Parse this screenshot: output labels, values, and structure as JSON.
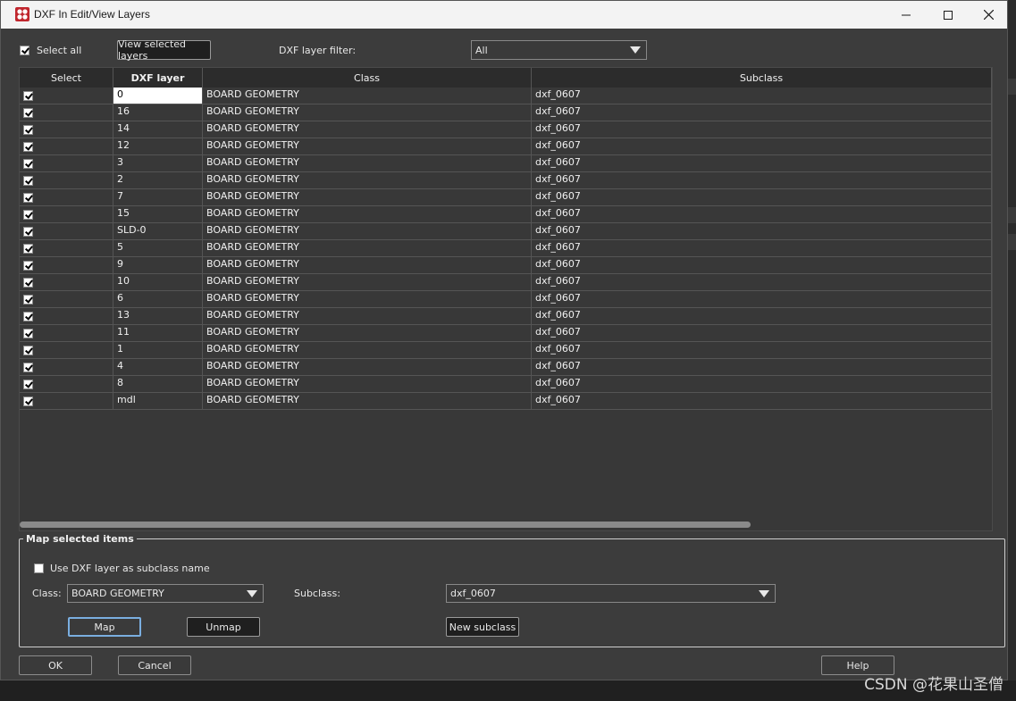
{
  "window": {
    "title": "DXF In Edit/View Layers"
  },
  "toolbar": {
    "select_all_label": "Select all",
    "select_all_checked": true,
    "view_selected_label": "View selected layers",
    "filter_label": "DXF layer filter:",
    "filter_value": "All"
  },
  "table": {
    "headers": [
      "Select",
      "DXF layer",
      "Class",
      "Subclass"
    ],
    "rows": [
      {
        "checked": true,
        "layer": "0",
        "class": "BOARD GEOMETRY",
        "subclass": "dxf_0607"
      },
      {
        "checked": true,
        "layer": "16",
        "class": "BOARD GEOMETRY",
        "subclass": "dxf_0607"
      },
      {
        "checked": true,
        "layer": "14",
        "class": "BOARD GEOMETRY",
        "subclass": "dxf_0607"
      },
      {
        "checked": true,
        "layer": "12",
        "class": "BOARD GEOMETRY",
        "subclass": "dxf_0607"
      },
      {
        "checked": true,
        "layer": "3",
        "class": "BOARD GEOMETRY",
        "subclass": "dxf_0607"
      },
      {
        "checked": true,
        "layer": "2",
        "class": "BOARD GEOMETRY",
        "subclass": "dxf_0607"
      },
      {
        "checked": true,
        "layer": "7",
        "class": "BOARD GEOMETRY",
        "subclass": "dxf_0607"
      },
      {
        "checked": true,
        "layer": "15",
        "class": "BOARD GEOMETRY",
        "subclass": "dxf_0607"
      },
      {
        "checked": true,
        "layer": "SLD-0",
        "class": "BOARD GEOMETRY",
        "subclass": "dxf_0607"
      },
      {
        "checked": true,
        "layer": "5",
        "class": "BOARD GEOMETRY",
        "subclass": "dxf_0607"
      },
      {
        "checked": true,
        "layer": "9",
        "class": "BOARD GEOMETRY",
        "subclass": "dxf_0607"
      },
      {
        "checked": true,
        "layer": "10",
        "class": "BOARD GEOMETRY",
        "subclass": "dxf_0607"
      },
      {
        "checked": true,
        "layer": "6",
        "class": "BOARD GEOMETRY",
        "subclass": "dxf_0607"
      },
      {
        "checked": true,
        "layer": "13",
        "class": "BOARD GEOMETRY",
        "subclass": "dxf_0607"
      },
      {
        "checked": true,
        "layer": "11",
        "class": "BOARD GEOMETRY",
        "subclass": "dxf_0607"
      },
      {
        "checked": true,
        "layer": "1",
        "class": "BOARD GEOMETRY",
        "subclass": "dxf_0607"
      },
      {
        "checked": true,
        "layer": "4",
        "class": "BOARD GEOMETRY",
        "subclass": "dxf_0607"
      },
      {
        "checked": true,
        "layer": "8",
        "class": "BOARD GEOMETRY",
        "subclass": "dxf_0607"
      },
      {
        "checked": true,
        "layer": "mdl",
        "class": "BOARD GEOMETRY",
        "subclass": "dxf_0607"
      }
    ]
  },
  "map_group": {
    "legend": "Map selected items",
    "use_layer_label": "Use DXF layer as subclass name",
    "use_layer_checked": false,
    "class_label": "Class:",
    "class_value": "BOARD GEOMETRY",
    "subclass_label": "Subclass:",
    "subclass_value": "dxf_0607",
    "map_label": "Map",
    "unmap_label": "Unmap",
    "new_subclass_label": "New subclass"
  },
  "footer": {
    "ok_label": "OK",
    "cancel_label": "Cancel",
    "help_label": "Help"
  },
  "watermark": "CSDN @花果山圣僧",
  "colors": {
    "window_bg": "#3c3c3c",
    "titlebar_bg": "#f3f3f3",
    "focus_border": "#7aaee0"
  }
}
